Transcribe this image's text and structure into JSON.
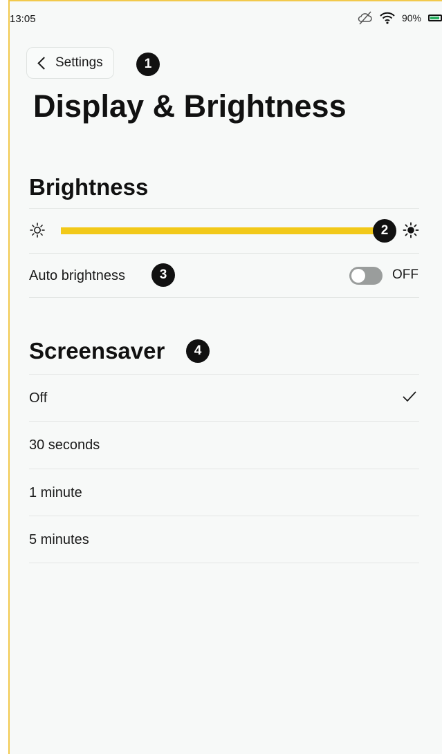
{
  "status_bar": {
    "time": "13:05",
    "battery": "90%",
    "icons": [
      "sync-off-icon",
      "wifi-icon",
      "battery-icon"
    ],
    "battery_level": 0.9,
    "battery_color": "#27ae60"
  },
  "header": {
    "back_label": "Settings",
    "title": "Display & Brightness"
  },
  "annotations": [
    "1",
    "2",
    "3",
    "4"
  ],
  "brightness": {
    "heading": "Brightness",
    "level": 1.0,
    "accent_color": "#f2c919",
    "auto_label": "Auto brightness",
    "auto_state": "OFF",
    "auto_enabled": false
  },
  "screensaver": {
    "heading": "Screensaver",
    "options": [
      {
        "label": "Off",
        "selected": true
      },
      {
        "label": "30 seconds",
        "selected": false
      },
      {
        "label": "1 minute",
        "selected": false
      },
      {
        "label": "5 minutes",
        "selected": false
      }
    ]
  }
}
